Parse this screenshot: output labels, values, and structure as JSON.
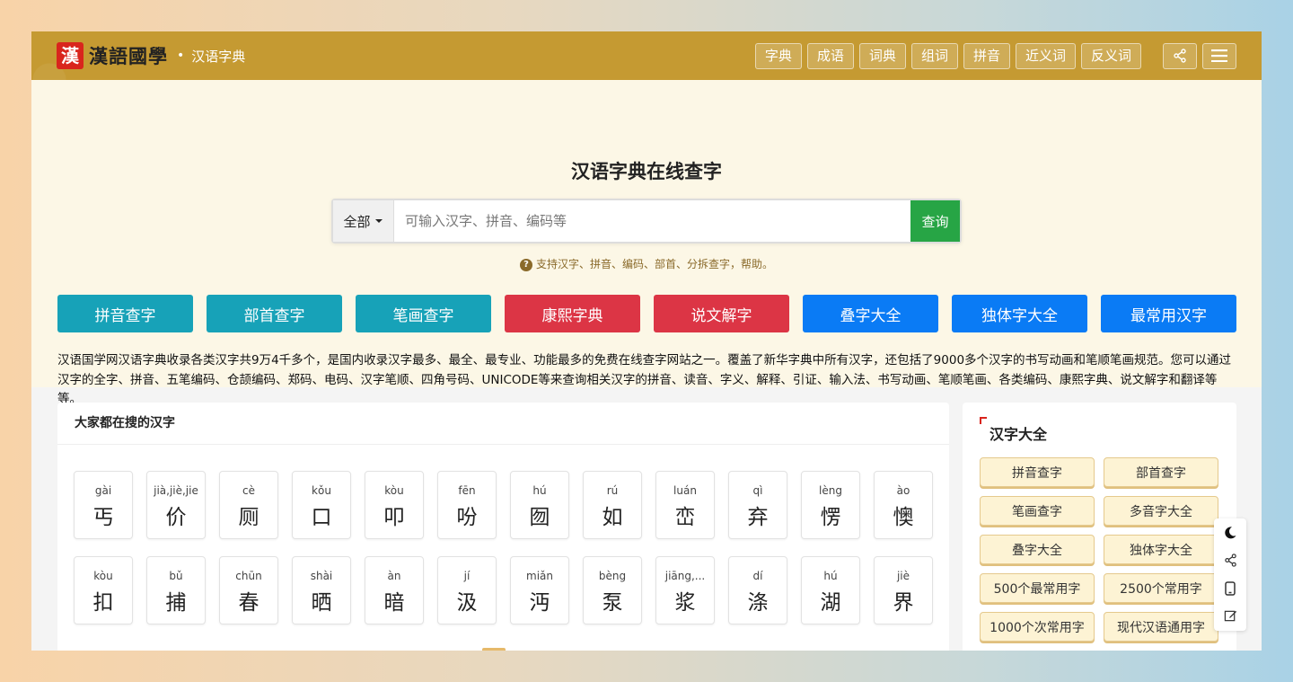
{
  "header": {
    "logo_glyph": "漢",
    "logo_text": "漢語國學",
    "dot": "•",
    "site_section": "汉语字典",
    "nav": [
      "字典",
      "成语",
      "词典",
      "组词",
      "拼音",
      "近义词",
      "反义词"
    ],
    "icons": [
      "share-icon",
      "menu-icon"
    ]
  },
  "hero": {
    "title": "汉语字典在线查字",
    "search": {
      "category": "全部",
      "placeholder": "可输入汉字、拼音、编码等",
      "button": "查询"
    },
    "help_icon": "?",
    "help_text": "支持汉字、拼音、编码、部首、分拆查字，帮助。"
  },
  "tools": [
    {
      "label": "拼音查字",
      "color": "#17a2b8"
    },
    {
      "label": "部首查字",
      "color": "#17a2b8"
    },
    {
      "label": "笔画查字",
      "color": "#17a2b8"
    },
    {
      "label": "康熙字典",
      "color": "#dc3545"
    },
    {
      "label": "说文解字",
      "color": "#dc3545"
    },
    {
      "label": "叠字大全",
      "color": "#0a7bf5"
    },
    {
      "label": "独体字大全",
      "color": "#0a7bf5"
    },
    {
      "label": "最常用汉字",
      "color": "#0a7bf5"
    }
  ],
  "intro": "汉语国学网汉语字典收录各类汉字共9万4千多个，是国内收录汉字最多、最全、最专业、功能最多的免费在线查字网站之一。覆盖了新华字典中所有汉字，还包括了9000多个汉字的书写动画和笔顺笔画规范。您可以通过汉字的全字、拼音、五笔编码、仓颉编码、郑码、电码、汉字笔顺、四角号码、UNICODE等来查询相关汉字的拼音、读音、字义、解释、引证、输入法、书写动画、笔顺笔画、各类编码、康熙字典、说文解字和翻译等等。",
  "hot": {
    "title": "大家都在搜的汉字",
    "rows": [
      [
        {
          "py": "gài",
          "zi": "丐"
        },
        {
          "py": "jià,jiè,jie",
          "zi": "价"
        },
        {
          "py": "cè",
          "zi": "厕"
        },
        {
          "py": "kǒu",
          "zi": "口"
        },
        {
          "py": "kòu",
          "zi": "叩"
        },
        {
          "py": "fēn",
          "zi": "吩"
        },
        {
          "py": "hú",
          "zi": "囫"
        },
        {
          "py": "rú",
          "zi": "如"
        },
        {
          "py": "luán",
          "zi": "峦"
        },
        {
          "py": "qì",
          "zi": "弃"
        },
        {
          "py": "lèng",
          "zi": "愣"
        },
        {
          "py": "ào",
          "zi": "懊"
        }
      ],
      [
        {
          "py": "kòu",
          "zi": "扣"
        },
        {
          "py": "bǔ",
          "zi": "捕"
        },
        {
          "py": "chūn",
          "zi": "春"
        },
        {
          "py": "shài",
          "zi": "晒"
        },
        {
          "py": "àn",
          "zi": "暗"
        },
        {
          "py": "jí",
          "zi": "汲"
        },
        {
          "py": "miǎn",
          "zi": "沔"
        },
        {
          "py": "bèng",
          "zi": "泵"
        },
        {
          "py": "jiāng,...",
          "zi": "浆"
        },
        {
          "py": "dí",
          "zi": "涤"
        },
        {
          "py": "hú",
          "zi": "湖"
        },
        {
          "py": "jiè",
          "zi": "界"
        }
      ]
    ]
  },
  "side": {
    "title": "汉字大全",
    "buttons": [
      "拼音查字",
      "部首查字",
      "笔画查字",
      "多音字大全",
      "叠字大全",
      "独体字大全",
      "500个最常用字",
      "2500个常用字",
      "1000个次常用字",
      "现代汉语通用字"
    ]
  },
  "float_tools": [
    "moon-icon",
    "share-icon",
    "phone-icon",
    "edit-icon"
  ],
  "colors": {
    "header": "#c59a32",
    "hero_bg": "#fcf7e6",
    "search_button": "#27a545",
    "logo_red": "#d9251d"
  }
}
